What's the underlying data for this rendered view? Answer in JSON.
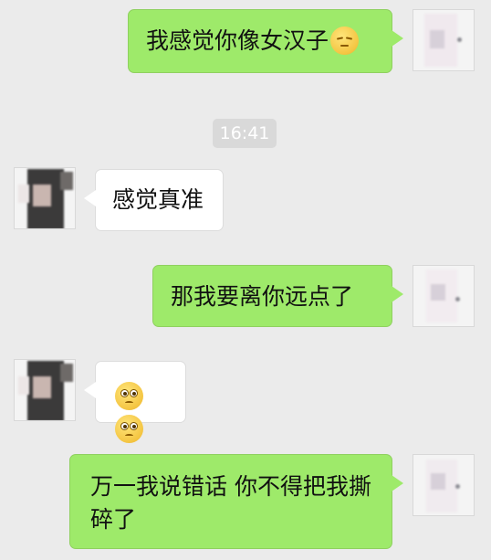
{
  "app": {
    "background_color": "#ebebeb",
    "outgoing_bubble_color": "#9eea6a",
    "incoming_bubble_color": "#ffffff"
  },
  "timestamp": "16:41",
  "messages": [
    {
      "direction": "outgoing",
      "text": "我感觉你像女汉子",
      "emoji": "pensive-face"
    },
    {
      "direction": "incoming",
      "text": "感觉真准"
    },
    {
      "direction": "outgoing",
      "text": "那我要离你远点了"
    },
    {
      "direction": "incoming",
      "text": "",
      "emoji": [
        "flushed-face",
        "flushed-face"
      ]
    },
    {
      "direction": "outgoing",
      "text": "万一我说错话 你不得把我撕碎了"
    }
  ]
}
